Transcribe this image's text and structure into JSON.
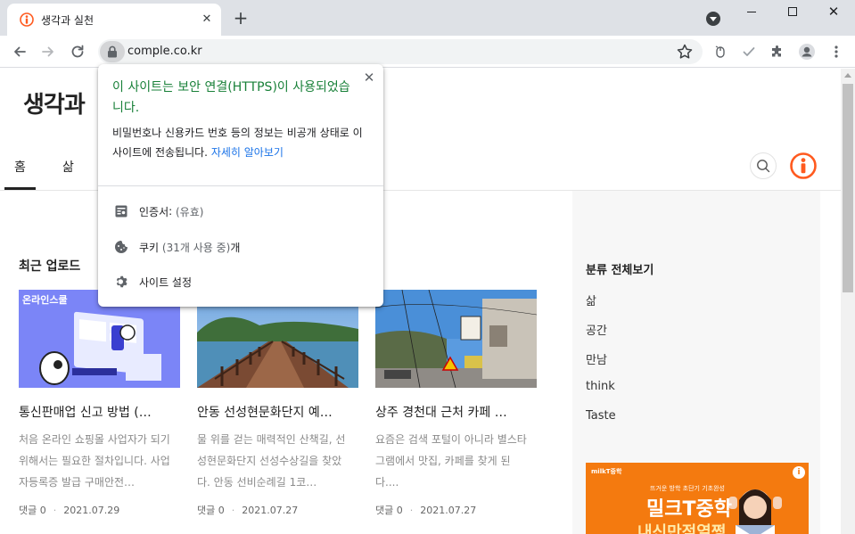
{
  "browser": {
    "tab_title": "생각과 실천",
    "url": "comple.co.kr",
    "tab_close": "✕",
    "new_tab": "+",
    "window_close": "✕"
  },
  "blog": {
    "title": "생각과",
    "nav": [
      "홈",
      "삶"
    ]
  },
  "recent": {
    "heading": "최근 업로드",
    "cards": [
      {
        "thumb_text": "온라인스쿨",
        "title": "통신판매업 신고 방법 (…",
        "desc": "처음 온라인 쇼핑몰 사업자가 되기 위해서는 필요한 절차입니다. 사업자등록증 발급 구매안전…",
        "comments": "댓글 0",
        "date": "2021.07.29"
      },
      {
        "title": "안동 선성현문화단지 예…",
        "desc": "물 위를 걷는 매력적인 산책길, 선성현문화단지 선성수상길을 찾았다. 안동 선비순례길 1코…",
        "comments": "댓글 0",
        "date": "2021.07.27"
      },
      {
        "title": "상주 경천대 근처 카페 …",
        "desc": "요즘은 검색 포털이 아니라 별스타그램에서 맛집, 카페를 찾게 된다....",
        "comments": "댓글 0",
        "date": "2021.07.27"
      }
    ]
  },
  "sidebar": {
    "heading": "분류 전체보기",
    "categories": [
      "삶",
      "공간",
      "만남",
      "think",
      "Taste"
    ],
    "ad": {
      "logo": "milkT중학",
      "top_line": "뜨거운 방학 초단기 기초완성",
      "main": "밀크T중학",
      "sub": "내신만점열쩡",
      "info": "i"
    }
  },
  "popup": {
    "title": "이 사이트는 보안 연결(HTTPS)이 사용되었습니다.",
    "desc": "비밀번호나 신용카드 번호 등의 정보는 비공개 상태로 이 사이트에 전송됩니다.",
    "learn_more": "자세히 알아보기",
    "close": "✕",
    "certificate_label": "인증서",
    "certificate_status": "(유효)",
    "cookies_label": "쿠키",
    "cookies_count": "(31개 사용 중)",
    "cookies_suffix": "개",
    "site_settings": "사이트 설정"
  },
  "colors": {
    "secure_green": "#188038",
    "link_blue": "#1a73e8",
    "brand_orange": "#ff5a1f"
  }
}
